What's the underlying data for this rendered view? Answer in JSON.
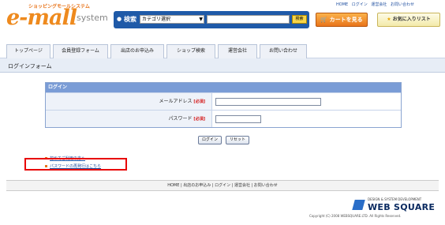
{
  "header": {
    "logo_tagline": "ショッピングモールシステム",
    "logo_main": "e-mall",
    "logo_sub": "system",
    "search_label": "検索",
    "category_select": "カテゴリ選択",
    "search_button": "検索",
    "top_links": [
      "HOME",
      "ログイン",
      "運営会社",
      "お問い合わせ"
    ],
    "cart_button": "カートを見る",
    "favorites_button": "お気に入りリスト"
  },
  "nav": {
    "tabs": [
      "トップページ",
      "会員登録フォーム",
      "出店のお申込み",
      "ショップ検索",
      "運営会社",
      "お問い合わせ"
    ]
  },
  "page": {
    "title": "ログインフォーム"
  },
  "form": {
    "heading": "ログイン",
    "email_label": "メールアドレス",
    "password_label": "パスワード",
    "required": "[必須]",
    "login_button": "ログイン",
    "reset_button": "リセット"
  },
  "links": {
    "first_time": "初めてご利用の方へ",
    "password_reset": "パスワードの再発行はこちら"
  },
  "footer": {
    "nav": "HOME | 出店のお申込み | ログイン | 運営会社 | お問い合わせ",
    "company_tagline": "DESIGN & SYSTEM DEVELOPMENT",
    "company_name": "WEB SQUARE",
    "copyright": "Copyright (C) 2008 WEBSQUARE.LTD. All Rights Reserved."
  },
  "colors": {
    "brand_orange": "#ee8a1e",
    "search_blue": "#1f5aa8",
    "form_header": "#7a9cd6",
    "highlight_red": "#e80000"
  }
}
